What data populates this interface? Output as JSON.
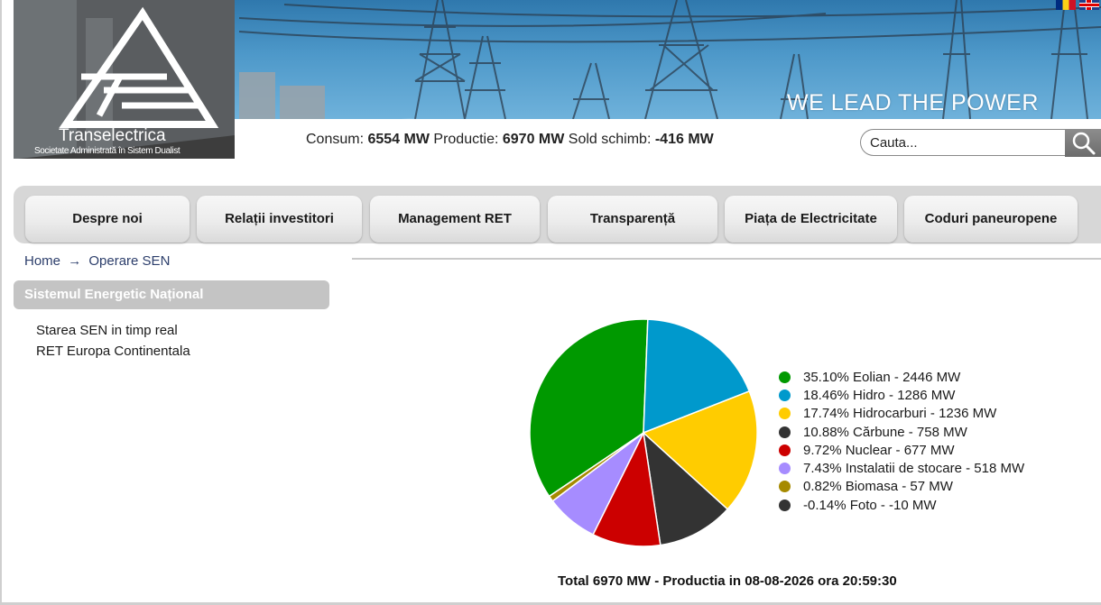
{
  "header": {
    "slogan": "WE LEAD THE POWER",
    "logo_name": "Transelectrica",
    "logo_sub": "Societate Administrată în Sistem Dualist"
  },
  "stats": {
    "consum_label": "Consum: ",
    "consum_value": "6554 MW",
    "productie_label": "Productie: ",
    "productie_value": "6970 MW",
    "sold_label": "Sold schimb: ",
    "sold_value": "-416 MW"
  },
  "search": {
    "placeholder": "Cauta...",
    "icon": "search-icon"
  },
  "nav": {
    "items": [
      {
        "label": "Despre noi"
      },
      {
        "label": "Relații investitori"
      },
      {
        "label": "Management RET"
      },
      {
        "label": "Transparență"
      },
      {
        "label": "Piața de Electricitate"
      },
      {
        "label": "Coduri paneuropene"
      }
    ]
  },
  "breadcrumb": {
    "home": "Home",
    "separator": "→",
    "current": "Operare SEN"
  },
  "sidebar": {
    "title": "Sistemul Energetic Național",
    "links": [
      {
        "label": "Starea SEN in timp real"
      },
      {
        "label": "RET Europa Continentala"
      }
    ]
  },
  "chart_data": {
    "type": "pie",
    "slices": [
      {
        "label": "35.10% Eolian - 2446 MW",
        "percent": 35.1,
        "value": 2446,
        "color": "#009900"
      },
      {
        "label": "18.46% Hidro - 1286 MW",
        "percent": 18.46,
        "value": 1286,
        "color": "#0099cc"
      },
      {
        "label": "17.74% Hidrocarburi - 1236 MW",
        "percent": 17.74,
        "value": 1236,
        "color": "#ffcc00"
      },
      {
        "label": "10.88% Cărbune - 758 MW",
        "percent": 10.88,
        "value": 758,
        "color": "#333333"
      },
      {
        "label": "9.72% Nuclear - 677 MW",
        "percent": 9.72,
        "value": 677,
        "color": "#cc0000"
      },
      {
        "label": "7.43% Instalatii de stocare - 518 MW",
        "percent": 7.43,
        "value": 518,
        "color": "#a68cff"
      },
      {
        "label": "0.82% Biomasa - 57 MW",
        "percent": 0.82,
        "value": 57,
        "color": "#a68a00"
      },
      {
        "label": "-0.14% Foto - -10 MW",
        "percent": -0.14,
        "value": -10,
        "color": "#333333"
      }
    ],
    "caption": "Total 6970 MW - Productia in 08-08-2026 ora 20:59:30",
    "legend_position": "right"
  }
}
